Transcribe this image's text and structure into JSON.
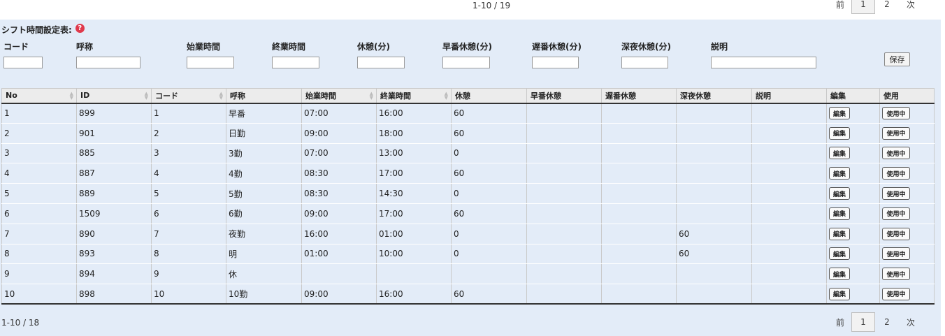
{
  "top_pager": {
    "info": "1-10 / 19",
    "prev": "前",
    "current": "1",
    "page2": "2",
    "next": "次"
  },
  "bottom_pager": {
    "info": "1-10 / 18",
    "prev": "前",
    "current": "1",
    "page2": "2",
    "next": "次"
  },
  "form": {
    "title": "シフト時間設定表:",
    "help_icon": "?",
    "labels": {
      "code": "コード",
      "name": "呼称",
      "start": "始業時間",
      "end": "終業時間",
      "break": "休憩(分)",
      "early_break": "早番休憩(分)",
      "late_break": "遅番休憩(分)",
      "night_break": "深夜休憩(分)",
      "desc": "説明"
    },
    "values": {
      "code": "",
      "name": "",
      "start": "",
      "end": "",
      "break": "",
      "early_break": "",
      "late_break": "",
      "night_break": "",
      "desc": ""
    },
    "save_label": "保存"
  },
  "table": {
    "headers": [
      "No",
      "ID",
      "コード",
      "呼称",
      "始業時間",
      "終業時間",
      "休憩",
      "早番休憩",
      "遅番休憩",
      "深夜休憩",
      "説明",
      "編集",
      "使用"
    ],
    "edit_label": "編集",
    "use_label": "使用中",
    "rows": [
      {
        "no": "1",
        "id": "899",
        "code": "1",
        "name": "早番",
        "start": "07:00",
        "end": "16:00",
        "break": "60",
        "early": "",
        "late": "",
        "night": "",
        "desc": ""
      },
      {
        "no": "2",
        "id": "901",
        "code": "2",
        "name": "日勤",
        "start": "09:00",
        "end": "18:00",
        "break": "60",
        "early": "",
        "late": "",
        "night": "",
        "desc": ""
      },
      {
        "no": "3",
        "id": "885",
        "code": "3",
        "name": "3勤",
        "start": "07:00",
        "end": "13:00",
        "break": "0",
        "early": "",
        "late": "",
        "night": "",
        "desc": ""
      },
      {
        "no": "4",
        "id": "887",
        "code": "4",
        "name": "4勤",
        "start": "08:30",
        "end": "17:00",
        "break": "60",
        "early": "",
        "late": "",
        "night": "",
        "desc": ""
      },
      {
        "no": "5",
        "id": "889",
        "code": "5",
        "name": "5勤",
        "start": "08:30",
        "end": "14:30",
        "break": "0",
        "early": "",
        "late": "",
        "night": "",
        "desc": ""
      },
      {
        "no": "6",
        "id": "1509",
        "code": "6",
        "name": "6勤",
        "start": "09:00",
        "end": "17:00",
        "break": "60",
        "early": "",
        "late": "",
        "night": "",
        "desc": ""
      },
      {
        "no": "7",
        "id": "890",
        "code": "7",
        "name": "夜勤",
        "start": "16:00",
        "end": "01:00",
        "break": "0",
        "early": "",
        "late": "",
        "night": "60",
        "desc": ""
      },
      {
        "no": "8",
        "id": "893",
        "code": "8",
        "name": "明",
        "start": "01:00",
        "end": "10:00",
        "break": "0",
        "early": "",
        "late": "",
        "night": "60",
        "desc": ""
      },
      {
        "no": "9",
        "id": "894",
        "code": "9",
        "name": "休",
        "start": "",
        "end": "",
        "break": "",
        "early": "",
        "late": "",
        "night": "",
        "desc": ""
      },
      {
        "no": "10",
        "id": "898",
        "code": "10",
        "name": "10勤",
        "start": "09:00",
        "end": "16:00",
        "break": "60",
        "early": "",
        "late": "",
        "night": "",
        "desc": ""
      }
    ]
  }
}
